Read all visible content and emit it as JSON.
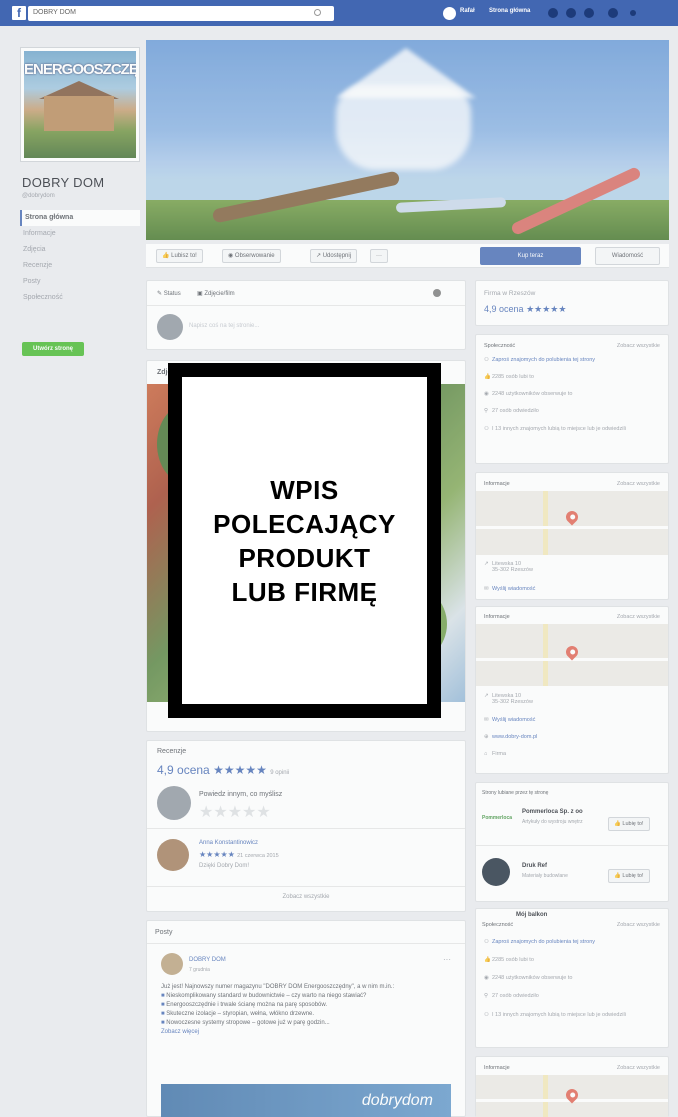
{
  "topbar": {
    "logo": "f",
    "search_value": "DOBRY DOM",
    "user": "Rafał",
    "home": "Strona główna"
  },
  "page": {
    "name": "DOBRY DOM",
    "handle": "@dobrydom",
    "magazine_title": "ENERGOOSZCZĘDNY",
    "nav": [
      "Strona główna",
      "Informacje",
      "Zdjęcia",
      "Recenzje",
      "Posty",
      "Społeczność"
    ],
    "promote_label": "Utwórz stronę"
  },
  "actions": {
    "like": "Lubisz to!",
    "follow": "Obserwowanie",
    "share": "Udostępnij",
    "more": "···",
    "buy": "Kup teraz",
    "message": "Wiadomość"
  },
  "composer": {
    "status_tab": "Status",
    "photo_tab": "Zdjęcie/film",
    "placeholder": "Napisz coś na tej stronie..."
  },
  "photos_label": "Zdjęcia",
  "overlay": {
    "lines": [
      "WPIS",
      "POLECAJĄCY",
      "PRODUKT",
      "LUB FIRMĘ"
    ]
  },
  "reviews": {
    "title": "Recenzje",
    "rating": "4,9 ocena",
    "stars": "★★★★★",
    "count": "9 opinii",
    "prompt": "Powiedz innym, co myślisz",
    "empty_stars": "★★★★★",
    "reviewer": "Anna Konstantinowicz",
    "review_date": "21 czerwca 2015",
    "review_text": "Dzięki Dobry Dom!",
    "see_all": "Zobacz wszystkie"
  },
  "posts": {
    "title": "Posty",
    "author": "DOBRY DOM",
    "time": "7 grudnia",
    "lines": [
      "Już jest! Najnowszy numer magazynu \"DOBRY DOM Energooszczędny\", a w nim m.in.:",
      "Nieskomplikowany standard w budownictwie – czy warto na niego stawiać?",
      "Energooszczędnie i trwale ścianę można na parę sposobów.",
      "Skuteczne izolacje – styropian, wełna, włókno drzewne.",
      "Nowoczesne systemy stropowe – gotowe już w parę godzin..."
    ],
    "more": "Zobacz więcej",
    "image_text": "dobrydom"
  },
  "right": {
    "category": "Firma w Rzeszów",
    "rating": "4,9 ocena",
    "stars": "★★★★★",
    "community": {
      "title": "Społeczność",
      "see_all": "Zobacz wszystkie",
      "rows": [
        "Zaproś znajomych do polubienia tej strony",
        "2285 osób lubi to",
        "2248 użytkowników obserwuje to",
        "27 osób odwiedziło",
        "I 13 innych znajomych lubią to miejsce lub je odwiedzili"
      ]
    },
    "info": {
      "title": "Informacje",
      "see_all": "Zobacz wszystkie",
      "address": "Litewska 10",
      "city": "35-302 Rzeszów",
      "directions": "Wyślij wiadomość",
      "website": "www.dobry-dom.pl",
      "type": "Firma"
    },
    "related": {
      "title": "Strony lubiane przez tę stronę",
      "items": [
        {
          "name": "Pommerloca Sp. z oo",
          "desc": "Artykuły do wystroju wnętrz",
          "btn": "Lubię to!"
        },
        {
          "name": "Druk Ref",
          "desc": "Materiały budowlane",
          "btn": "Lubię to!"
        },
        {
          "name": "Mój balkon",
          "desc": "",
          "btn": "Lubię to!"
        }
      ]
    }
  }
}
